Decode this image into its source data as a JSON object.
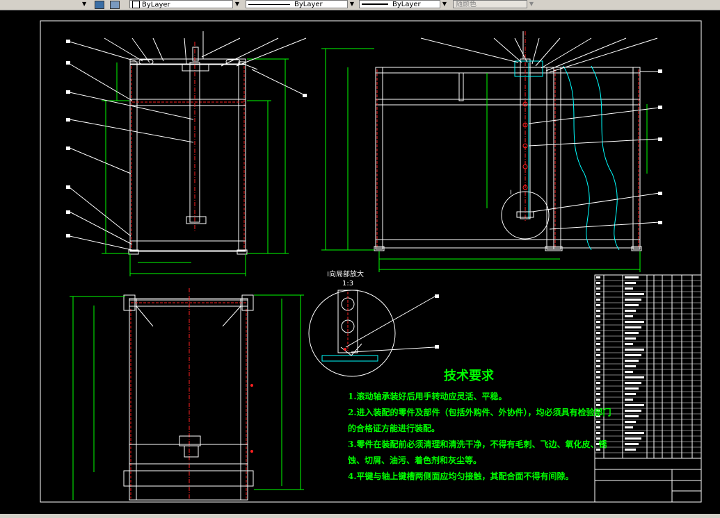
{
  "toolbar": {
    "layer_color": "ByLayer",
    "linetype": "ByLayer",
    "lineweight": "ByLayer",
    "plot_style": "随颜色"
  },
  "drawing": {
    "detail_title": "I向局部放大",
    "detail_scale": "1:3",
    "detail_marker": "I",
    "requirements_title": "技术要求",
    "requirements": [
      "1.滚动轴承装好后用手转动应灵活、平稳。",
      "2.进入装配的零件及部件（包括外购件、外协件），均必须具有检验部门",
      "的合格证方能进行装配。",
      "3.零件在装配前必须清理和清洗干净，不得有毛刺、飞边、氧化皮、锈",
      "蚀、切屑、油污、着色剂和灰尘等。",
      "4.平键与轴上键槽两侧面应均匀接触，其配合面不得有间隙。"
    ]
  },
  "colors": {
    "frame": "#ffffff",
    "outline": "#ffffff",
    "dimension": "#00ff00",
    "center": "#ff0000",
    "cyan": "#00ffff",
    "yellow": "#ffff00",
    "text_green": "#00ff00"
  }
}
